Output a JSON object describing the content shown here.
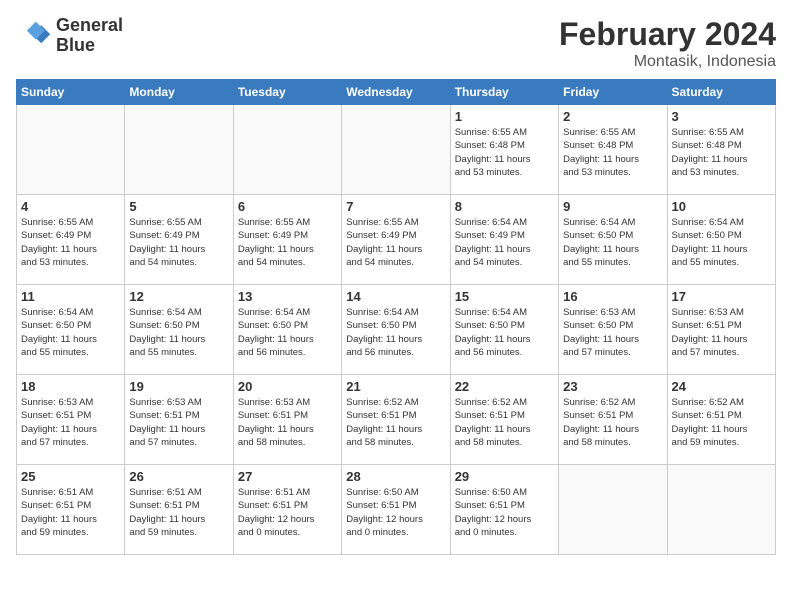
{
  "header": {
    "logo_line1": "General",
    "logo_line2": "Blue",
    "month_year": "February 2024",
    "location": "Montasik, Indonesia"
  },
  "days_of_week": [
    "Sunday",
    "Monday",
    "Tuesday",
    "Wednesday",
    "Thursday",
    "Friday",
    "Saturday"
  ],
  "weeks": [
    [
      {
        "day": "",
        "info": ""
      },
      {
        "day": "",
        "info": ""
      },
      {
        "day": "",
        "info": ""
      },
      {
        "day": "",
        "info": ""
      },
      {
        "day": "1",
        "info": "Sunrise: 6:55 AM\nSunset: 6:48 PM\nDaylight: 11 hours\nand 53 minutes."
      },
      {
        "day": "2",
        "info": "Sunrise: 6:55 AM\nSunset: 6:48 PM\nDaylight: 11 hours\nand 53 minutes."
      },
      {
        "day": "3",
        "info": "Sunrise: 6:55 AM\nSunset: 6:48 PM\nDaylight: 11 hours\nand 53 minutes."
      }
    ],
    [
      {
        "day": "4",
        "info": "Sunrise: 6:55 AM\nSunset: 6:49 PM\nDaylight: 11 hours\nand 53 minutes."
      },
      {
        "day": "5",
        "info": "Sunrise: 6:55 AM\nSunset: 6:49 PM\nDaylight: 11 hours\nand 54 minutes."
      },
      {
        "day": "6",
        "info": "Sunrise: 6:55 AM\nSunset: 6:49 PM\nDaylight: 11 hours\nand 54 minutes."
      },
      {
        "day": "7",
        "info": "Sunrise: 6:55 AM\nSunset: 6:49 PM\nDaylight: 11 hours\nand 54 minutes."
      },
      {
        "day": "8",
        "info": "Sunrise: 6:54 AM\nSunset: 6:49 PM\nDaylight: 11 hours\nand 54 minutes."
      },
      {
        "day": "9",
        "info": "Sunrise: 6:54 AM\nSunset: 6:50 PM\nDaylight: 11 hours\nand 55 minutes."
      },
      {
        "day": "10",
        "info": "Sunrise: 6:54 AM\nSunset: 6:50 PM\nDaylight: 11 hours\nand 55 minutes."
      }
    ],
    [
      {
        "day": "11",
        "info": "Sunrise: 6:54 AM\nSunset: 6:50 PM\nDaylight: 11 hours\nand 55 minutes."
      },
      {
        "day": "12",
        "info": "Sunrise: 6:54 AM\nSunset: 6:50 PM\nDaylight: 11 hours\nand 55 minutes."
      },
      {
        "day": "13",
        "info": "Sunrise: 6:54 AM\nSunset: 6:50 PM\nDaylight: 11 hours\nand 56 minutes."
      },
      {
        "day": "14",
        "info": "Sunrise: 6:54 AM\nSunset: 6:50 PM\nDaylight: 11 hours\nand 56 minutes."
      },
      {
        "day": "15",
        "info": "Sunrise: 6:54 AM\nSunset: 6:50 PM\nDaylight: 11 hours\nand 56 minutes."
      },
      {
        "day": "16",
        "info": "Sunrise: 6:53 AM\nSunset: 6:50 PM\nDaylight: 11 hours\nand 57 minutes."
      },
      {
        "day": "17",
        "info": "Sunrise: 6:53 AM\nSunset: 6:51 PM\nDaylight: 11 hours\nand 57 minutes."
      }
    ],
    [
      {
        "day": "18",
        "info": "Sunrise: 6:53 AM\nSunset: 6:51 PM\nDaylight: 11 hours\nand 57 minutes."
      },
      {
        "day": "19",
        "info": "Sunrise: 6:53 AM\nSunset: 6:51 PM\nDaylight: 11 hours\nand 57 minutes."
      },
      {
        "day": "20",
        "info": "Sunrise: 6:53 AM\nSunset: 6:51 PM\nDaylight: 11 hours\nand 58 minutes."
      },
      {
        "day": "21",
        "info": "Sunrise: 6:52 AM\nSunset: 6:51 PM\nDaylight: 11 hours\nand 58 minutes."
      },
      {
        "day": "22",
        "info": "Sunrise: 6:52 AM\nSunset: 6:51 PM\nDaylight: 11 hours\nand 58 minutes."
      },
      {
        "day": "23",
        "info": "Sunrise: 6:52 AM\nSunset: 6:51 PM\nDaylight: 11 hours\nand 58 minutes."
      },
      {
        "day": "24",
        "info": "Sunrise: 6:52 AM\nSunset: 6:51 PM\nDaylight: 11 hours\nand 59 minutes."
      }
    ],
    [
      {
        "day": "25",
        "info": "Sunrise: 6:51 AM\nSunset: 6:51 PM\nDaylight: 11 hours\nand 59 minutes."
      },
      {
        "day": "26",
        "info": "Sunrise: 6:51 AM\nSunset: 6:51 PM\nDaylight: 11 hours\nand 59 minutes."
      },
      {
        "day": "27",
        "info": "Sunrise: 6:51 AM\nSunset: 6:51 PM\nDaylight: 12 hours\nand 0 minutes."
      },
      {
        "day": "28",
        "info": "Sunrise: 6:50 AM\nSunset: 6:51 PM\nDaylight: 12 hours\nand 0 minutes."
      },
      {
        "day": "29",
        "info": "Sunrise: 6:50 AM\nSunset: 6:51 PM\nDaylight: 12 hours\nand 0 minutes."
      },
      {
        "day": "",
        "info": ""
      },
      {
        "day": "",
        "info": ""
      }
    ]
  ]
}
